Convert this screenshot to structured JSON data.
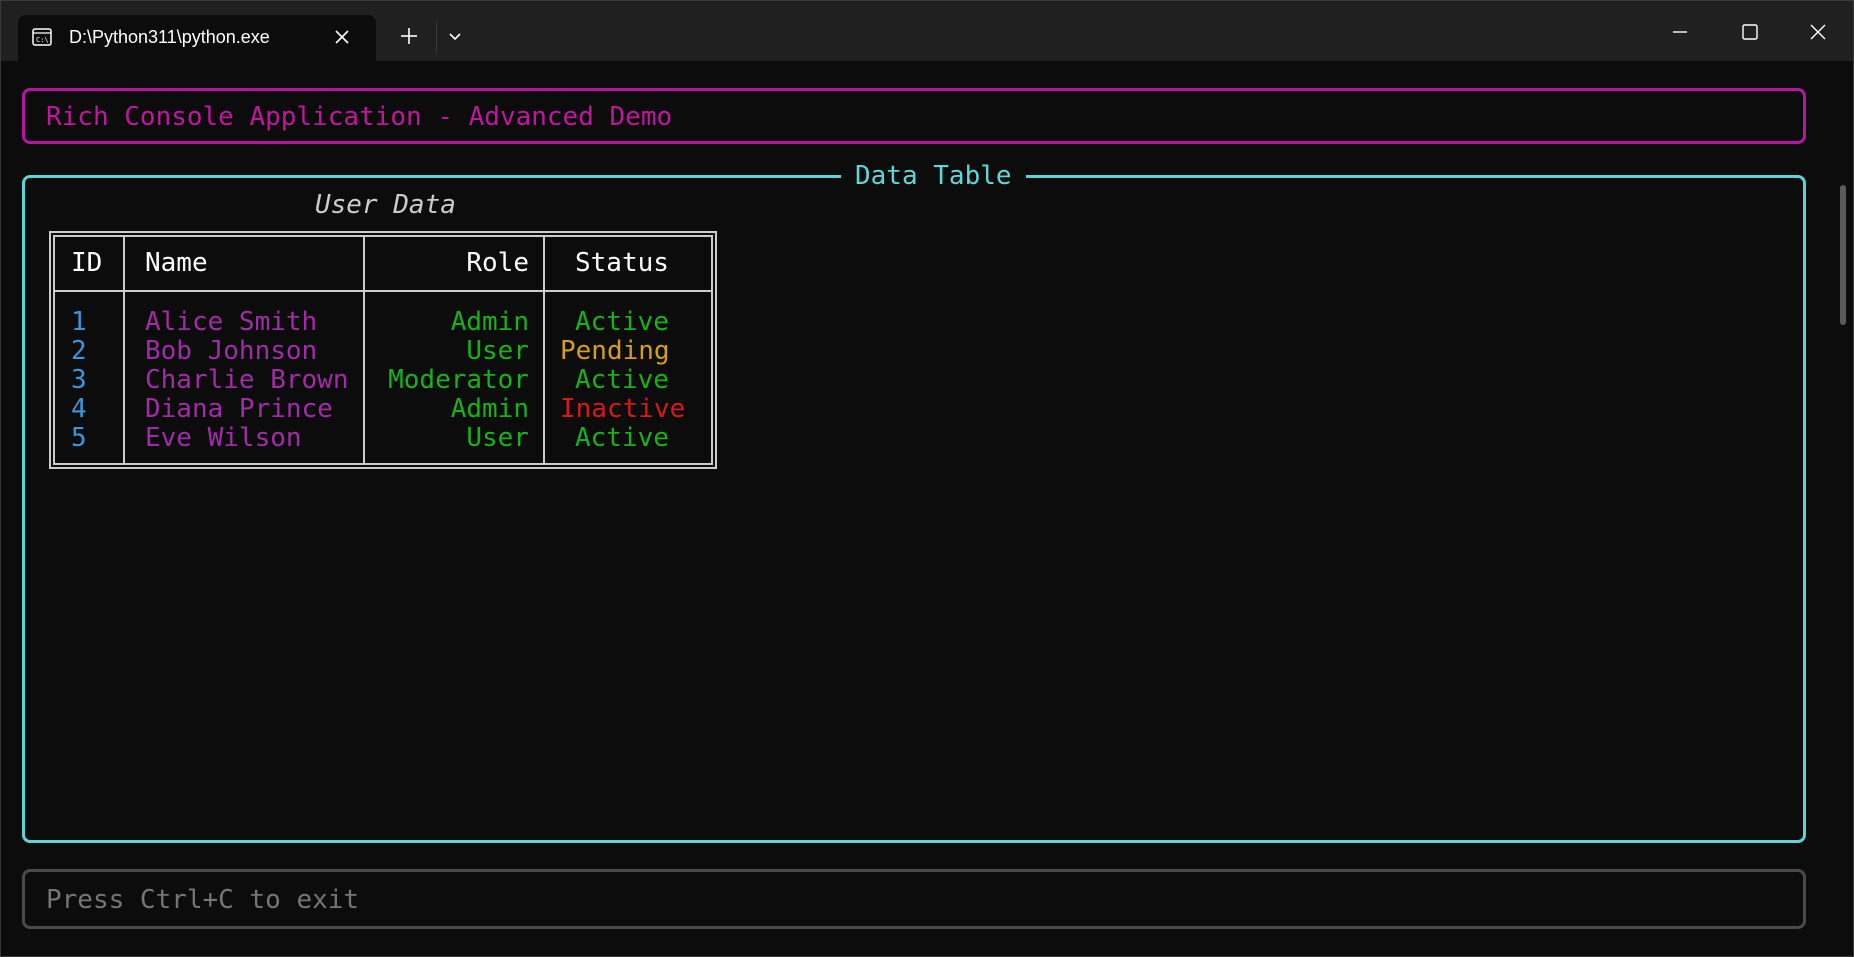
{
  "window": {
    "tab_title": "D:\\Python311\\python.exe"
  },
  "header_panel": {
    "text": "Rich Console Application - Advanced Demo"
  },
  "data_panel": {
    "title": "Data Table",
    "table_caption": "User Data",
    "columns": [
      "ID",
      "Name",
      "Role",
      "Status"
    ],
    "rows": [
      {
        "id": "1",
        "name": "Alice Smith",
        "role": "Admin",
        "status": "Active",
        "status_kind": "active"
      },
      {
        "id": "2",
        "name": "Bob Johnson",
        "role": "User",
        "status": "Pending",
        "status_kind": "pending"
      },
      {
        "id": "3",
        "name": "Charlie Brown",
        "role": "Moderator",
        "status": "Active",
        "status_kind": "active"
      },
      {
        "id": "4",
        "name": "Diana Prince",
        "role": "Admin",
        "status": "Inactive",
        "status_kind": "inactive"
      },
      {
        "id": "5",
        "name": "Eve Wilson",
        "role": "User",
        "status": "Active",
        "status_kind": "active"
      }
    ]
  },
  "input_panel": {
    "placeholder": "Press Ctrl+C to exit"
  },
  "colors": {
    "header_border": "#b5179e",
    "data_border": "#5fd3d3",
    "status_active": "#16b316",
    "status_pending": "#d4a017",
    "status_inactive": "#d61a1a"
  },
  "icons": {
    "tab_icon": "terminal-icon",
    "close": "close-icon",
    "new_tab": "plus-icon",
    "dropdown": "chevron-down-icon",
    "minimize": "minimize-icon",
    "maximize": "maximize-icon",
    "window_close": "window-close-icon"
  }
}
